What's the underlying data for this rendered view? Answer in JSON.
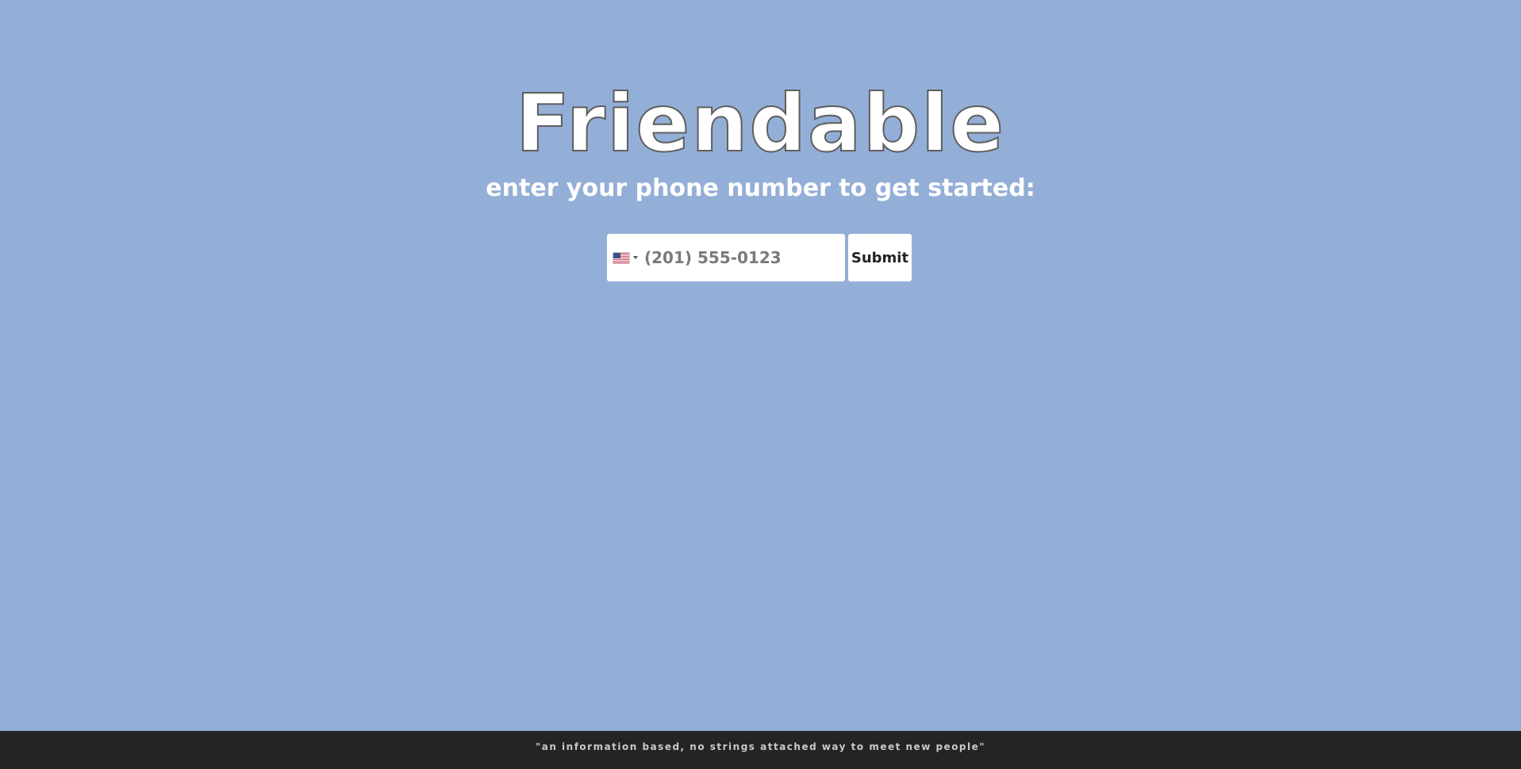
{
  "app": {
    "title": "Friendable",
    "subtitle": "enter your phone number to get started:"
  },
  "form": {
    "country_icon": "us-flag-icon",
    "phone_placeholder": "(201) 555-0123",
    "phone_value": "",
    "submit_label": "Submit"
  },
  "footer": {
    "tagline": "\"an information based, no strings attached way to meet new people\""
  },
  "colors": {
    "background": "#93afd7",
    "footer_background": "#242424",
    "title_fill": "#ffffff",
    "title_outline": "#5e5e5e"
  }
}
